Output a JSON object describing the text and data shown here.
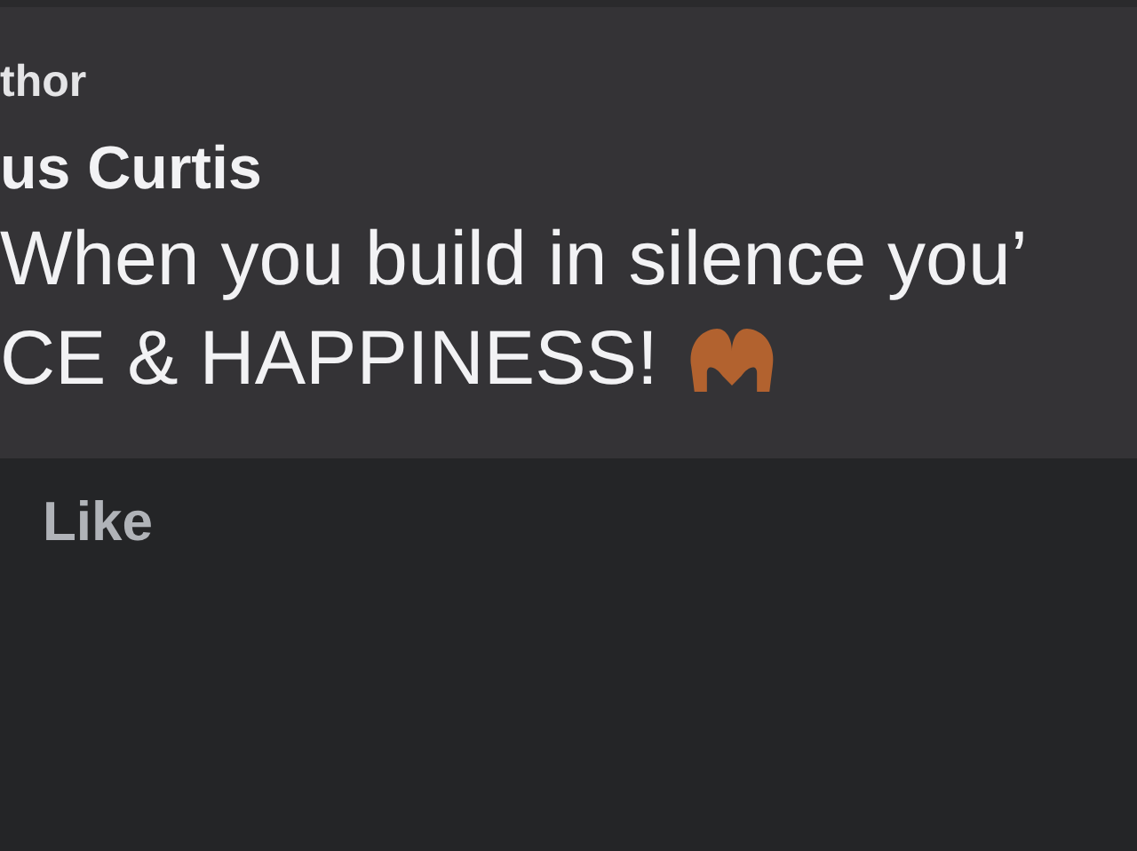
{
  "comment": {
    "badge": "thor",
    "author": "us Curtis",
    "text_lines": [
      "When you build in silence you’",
      "CE & HAPPINESS!"
    ]
  },
  "actions": [
    {
      "label": "Like"
    }
  ]
}
